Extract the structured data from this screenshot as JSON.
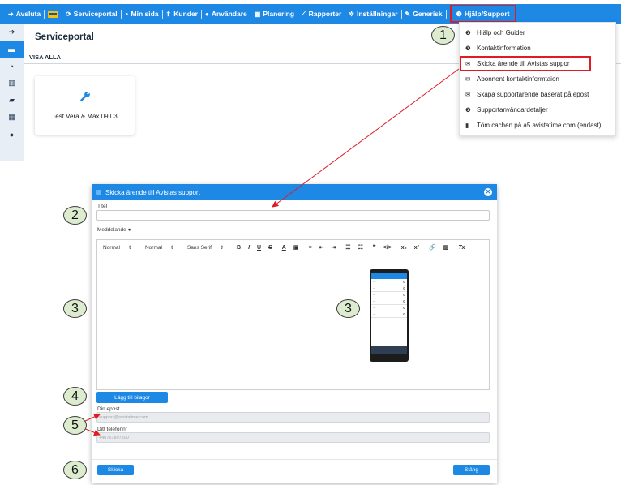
{
  "nav": {
    "items": [
      {
        "icon": "sign-out-icon",
        "glyph": "➜",
        "label": "Avsluta"
      },
      {
        "icon": "sync-icon",
        "glyph": "⟳",
        "label": "Serviceportal"
      },
      {
        "icon": "dashboard-icon",
        "glyph": "◔",
        "label": "Min sida"
      },
      {
        "icon": "user-tie-icon",
        "glyph": "⬆",
        "label": "Kunder"
      },
      {
        "icon": "user-icon",
        "glyph": "●",
        "label": "Användare"
      },
      {
        "icon": "calendar-icon",
        "glyph": "▦",
        "label": "Planering"
      },
      {
        "icon": "line-chart-icon",
        "glyph": "⟋",
        "label": "Rapporter"
      },
      {
        "icon": "cogs-icon",
        "glyph": "✲",
        "label": "Inställningar"
      },
      {
        "icon": "wrench-icon",
        "glyph": "✎",
        "label": "Generisk"
      },
      {
        "icon": "info-icon",
        "glyph": "❶",
        "label": "Hjälp/Support"
      }
    ]
  },
  "sidebar": {
    "items": [
      {
        "icon": "arrow-right-icon",
        "glyph": "➔"
      },
      {
        "icon": "id-card-icon",
        "glyph": "▬"
      },
      {
        "icon": "dashboard-icon",
        "glyph": "◔"
      },
      {
        "icon": "columns-icon",
        "glyph": "▥"
      },
      {
        "icon": "book-icon",
        "glyph": "▰"
      },
      {
        "icon": "th-icon",
        "glyph": "▦"
      },
      {
        "icon": "comments-icon",
        "glyph": "●"
      }
    ]
  },
  "portal": {
    "title": "Serviceportal",
    "filter": "VISA ALLA",
    "card_label": "Test Vera & Max 09.03"
  },
  "dropdown": {
    "items": [
      {
        "icon": "info-icon",
        "glyph": "❶",
        "label": "Hjälp och Guider"
      },
      {
        "icon": "info-icon",
        "glyph": "❶",
        "label": "Kontaktinformation"
      },
      {
        "icon": "envelope-open-icon",
        "glyph": "✉",
        "label": "Skicka ärende till Avistas suppor"
      },
      {
        "icon": "envelope-open-icon",
        "glyph": "✉",
        "label": "Abonnent kontaktinformtaion"
      },
      {
        "icon": "envelope-open-icon",
        "glyph": "✉",
        "label": "Skapa supportärende baserat på epost"
      },
      {
        "icon": "info-icon",
        "glyph": "❶",
        "label": "Supportanvändardetaljer"
      },
      {
        "icon": "trash-icon",
        "glyph": "▮",
        "label": "Töm cachen på a5.avistatime.com (endast)"
      }
    ]
  },
  "callouts": [
    "1",
    "2",
    "3",
    "3",
    "4",
    "5",
    "6"
  ],
  "modal": {
    "title": "Skicka ärende till Avistas support",
    "title_label": "Titel",
    "message_label": "Meddelande",
    "toolbar": {
      "format": "Normal",
      "size": "Normal",
      "font": "Sans Serif",
      "buttons": [
        "B",
        "I",
        "U",
        "S",
        "A",
        "▣",
        "≡",
        "⇤",
        "⇥",
        "☰",
        "☷",
        "❞",
        "</>",
        "x₂",
        "x²",
        "🔗",
        "▨",
        "Tx"
      ]
    },
    "attach_label": "Lägg till bilagor",
    "email_label": "Din epost",
    "email_value": "support@avistatime.com",
    "phone_label": "Ditt telefonnr",
    "phone_value": "+46767897800",
    "send_label": "Skicka",
    "close_label": "Stäng"
  },
  "colors": {
    "brand": "#1e88e5",
    "highlight": "#e01b24",
    "callout_fill": "#ddeccf"
  }
}
